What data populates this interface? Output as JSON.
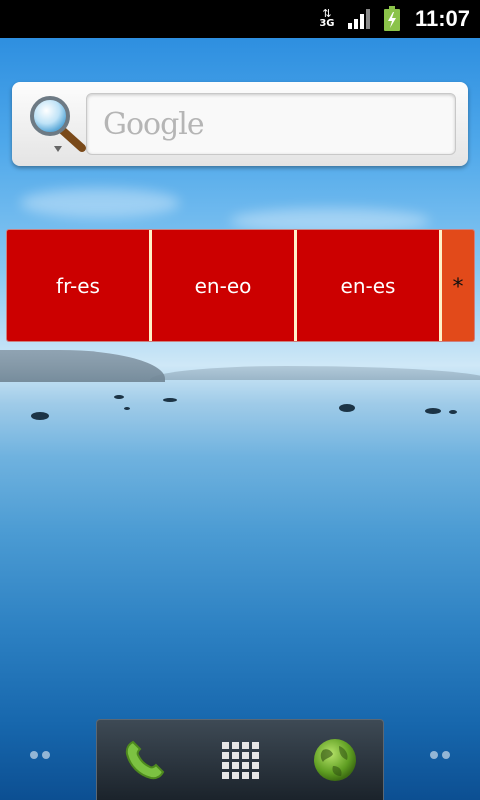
{
  "status_bar": {
    "network_label": "3G",
    "time": "11:07",
    "icons": [
      "data-activity-icon",
      "signal-icon",
      "battery-charging-icon"
    ]
  },
  "search_widget": {
    "placeholder": "Google",
    "icon": "search-icon"
  },
  "language_widget": {
    "pairs": [
      "fr-es",
      "en-eo",
      "en-es"
    ],
    "more_label": "*"
  },
  "dock": {
    "items": [
      "phone-icon",
      "app-drawer-icon",
      "browser-icon"
    ]
  },
  "colors": {
    "lang_button": "#cc0000",
    "lang_more": "#e24a1a",
    "divider": "#fff1c8"
  }
}
